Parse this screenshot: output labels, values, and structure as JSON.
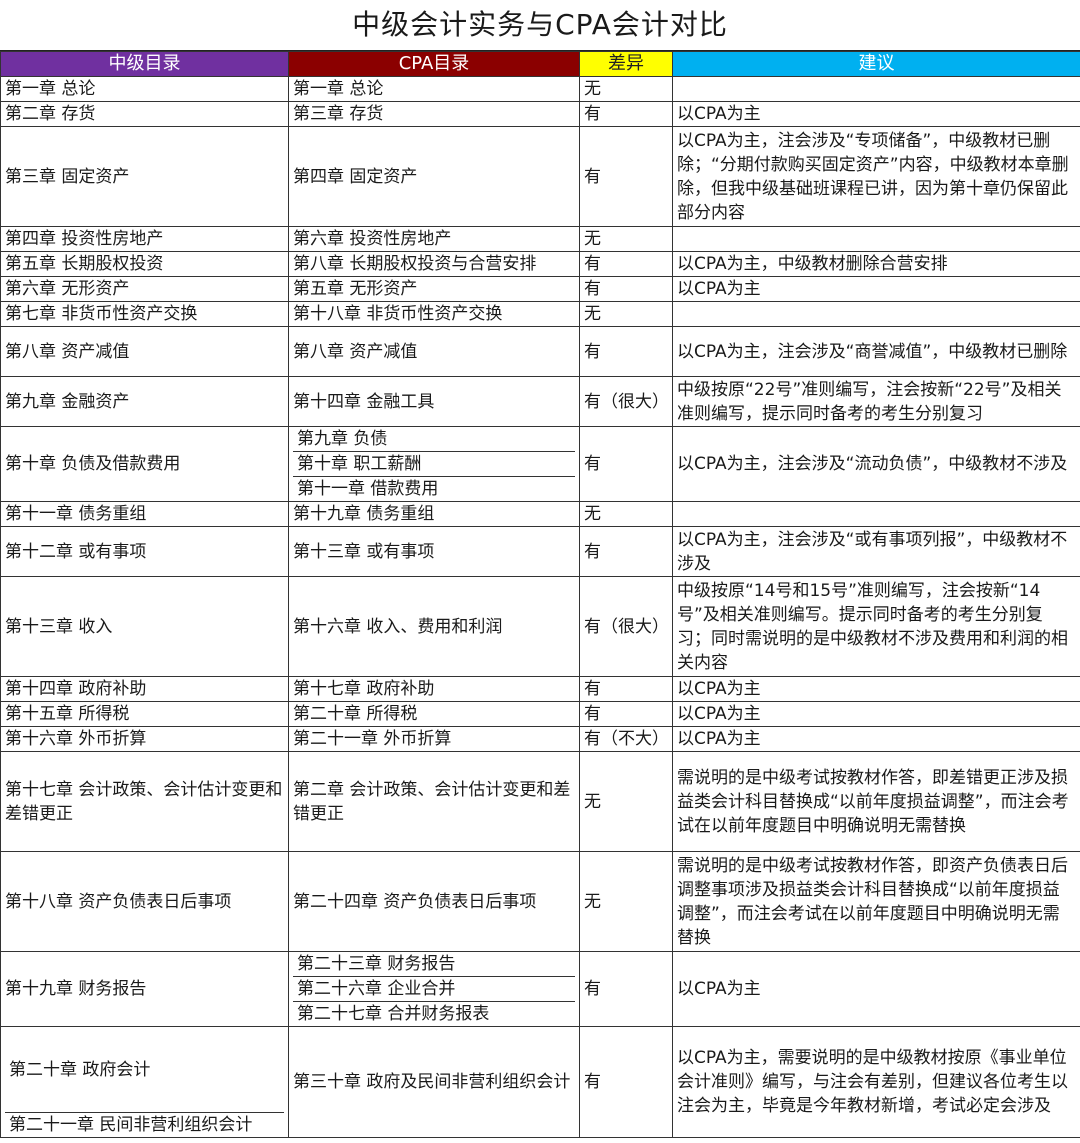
{
  "title": "中级会计实务与CPA会计对比",
  "headers": [
    "中级目录",
    "CPA目录",
    "差异",
    "建议"
  ],
  "header_colors": {
    "mid": "#7030a0",
    "cpa": "#8b0000",
    "diff": "#ffff00",
    "suggest": "#00b0f0"
  },
  "rows": [
    {
      "mid": "第一章 总论",
      "cpa": [
        "第一章 总论"
      ],
      "diff": "无",
      "sug": ""
    },
    {
      "mid": "第二章 存货",
      "cpa": [
        "第三章 存货"
      ],
      "diff": "有",
      "sug": "以CPA为主"
    },
    {
      "mid": "第三章 固定资产",
      "cpa": [
        "第四章 固定资产"
      ],
      "diff": "有",
      "sug": "以CPA为主，注会涉及“专项储备”，中级教材已删除；“分期付款购买固定资产”内容，中级教材本章删除，但我中级基础班课程已讲，因为第十章仍保留此部分内容"
    },
    {
      "mid": "第四章 投资性房地产",
      "cpa": [
        "第六章 投资性房地产"
      ],
      "diff": "无",
      "sug": ""
    },
    {
      "mid": "第五章 长期股权投资",
      "cpa": [
        "第八章 长期股权投资与合营安排"
      ],
      "diff": "有",
      "sug": "以CPA为主，中级教材删除合营安排"
    },
    {
      "mid": "第六章 无形资产",
      "cpa": [
        "第五章 无形资产"
      ],
      "diff": "有",
      "sug": "以CPA为主"
    },
    {
      "mid": "第七章 非货币性资产交换",
      "cpa": [
        "第十八章 非货币性资产交换"
      ],
      "diff": "无",
      "sug": ""
    },
    {
      "mid": "第八章 资产减值",
      "cpa": [
        "第八章 资产减值"
      ],
      "diff": "有",
      "sug": "以CPA为主，注会涉及“商誉减值”，中级教材已删除"
    },
    {
      "mid": "第九章 金融资产",
      "cpa": [
        "第十四章 金融工具"
      ],
      "diff": "有（很大）",
      "sug": "中级按原“22号”准则编写，注会按新“22号”及相关准则编写，提示同时备考的考生分别复习"
    },
    {
      "mid": "第十章 负债及借款费用",
      "cpa": [
        "第九章 负债",
        "第十章 职工薪酬",
        "第十一章 借款费用"
      ],
      "diff": "有",
      "sug": "以CPA为主，注会涉及“流动负债”，中级教材不涉及"
    },
    {
      "mid": "第十一章 债务重组",
      "cpa": [
        "第十九章 债务重组"
      ],
      "diff": "无",
      "sug": ""
    },
    {
      "mid": "第十二章 或有事项",
      "cpa": [
        "第十三章 或有事项"
      ],
      "diff": "有",
      "sug": "以CPA为主，注会涉及“或有事项列报”，中级教材不涉及"
    },
    {
      "mid": "第十三章 收入",
      "cpa": [
        "第十六章 收入、费用和利润"
      ],
      "diff": "有（很大）",
      "sug": "中级按原“14号和15号”准则编写，注会按新“14号”及相关准则编写。提示同时备考的考生分别复习；同时需说明的是中级教材不涉及费用和利润的相关内容"
    },
    {
      "mid": "第十四章 政府补助",
      "cpa": [
        "第十七章 政府补助"
      ],
      "diff": "有",
      "sug": "以CPA为主"
    },
    {
      "mid": "第十五章 所得税",
      "cpa": [
        "第二十章 所得税"
      ],
      "diff": "有",
      "sug": "以CPA为主"
    },
    {
      "mid": "第十六章 外币折算",
      "cpa": [
        "第二十一章 外币折算"
      ],
      "diff": "有（不大）",
      "sug": "以CPA为主"
    },
    {
      "mid": "第十七章 会计政策、会计估计变更和差错更正",
      "cpa": [
        "第二章 会计政策、会计估计变更和差错更正"
      ],
      "diff": "无",
      "sug": "需说明的是中级考试按教材作答，即差错更正涉及损益类会计科目替换成“以前年度损益调整”，而注会考试在以前年度题目中明确说明无需替换"
    },
    {
      "mid": "第十八章 资产负债表日后事项",
      "cpa": [
        "第二十四章 资产负债表日后事项"
      ],
      "diff": "无",
      "sug": "需说明的是中级考试按教材作答，即资产负债表日后调整事项涉及损益类会计科目替换成“以前年度损益调整”，而注会考试在以前年度题目中明确说明无需替换"
    },
    {
      "mid": "第十九章 财务报告",
      "cpa": [
        "第二十三章 财务报告",
        "第二十六章 企业合并",
        "第二十七章 合并财务报表"
      ],
      "diff": "有",
      "sug": "以CPA为主"
    },
    {
      "mid": "第二十章 政府会计",
      "mid2": "第二十一章 民间非营利组织会计",
      "cpa": [
        "第三十章 政府及民间非营利组织会计"
      ],
      "diff": "有",
      "sug": "以CPA为主，需要说明的是中级教材按原《事业单位会计准则》编写，与注会有差别，但建议各位考生以注会为主，毕竟是今年教材新增，考试必定会涉及"
    }
  ]
}
